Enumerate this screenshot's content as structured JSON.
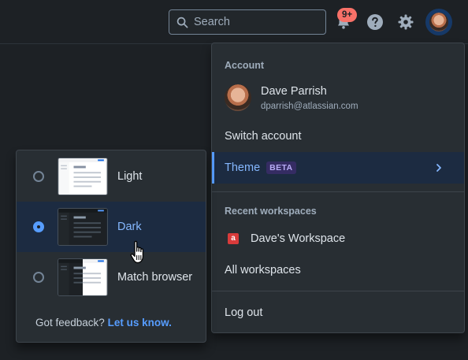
{
  "topbar": {
    "search_placeholder": "Search",
    "notifications_badge": "9+",
    "icons": [
      "search-icon",
      "bell-icon",
      "help-icon",
      "gear-icon",
      "avatar"
    ]
  },
  "account_menu": {
    "account_heading": "Account",
    "user": {
      "name": "Dave Parrish",
      "email": "dparrish@atlassian.com"
    },
    "switch_account": "Switch account",
    "theme": {
      "label": "Theme",
      "badge": "BETA"
    },
    "recent_heading": "Recent workspaces",
    "workspace": {
      "icon_letter": "a",
      "name": "Dave's Workspace"
    },
    "all_workspaces": "All workspaces",
    "logout": "Log out"
  },
  "theme_menu": {
    "options": [
      {
        "label": "Light",
        "selected": false
      },
      {
        "label": "Dark",
        "selected": true
      },
      {
        "label": "Match browser",
        "selected": false
      }
    ],
    "feedback_text": "Got feedback?",
    "feedback_link": "Let us know."
  },
  "colors": {
    "background": "#1d2125",
    "surface": "#282e33",
    "accent": "#579dff",
    "selected_bg": "#1c2b41",
    "badge": "#f87168",
    "beta_bg": "#352c63",
    "workspace_icon": "#d93b3b"
  }
}
